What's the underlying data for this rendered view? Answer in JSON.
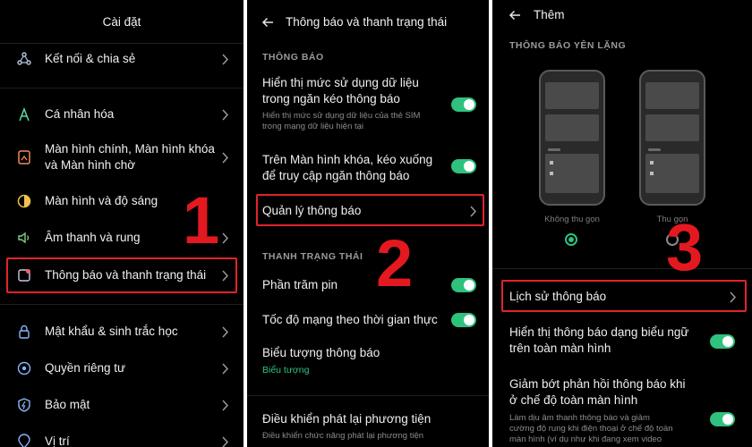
{
  "panel1": {
    "title": "Cài đặt",
    "items": [
      {
        "label": "Kết nối & chia sẻ",
        "icon": "share-icon"
      },
      {
        "label": "Cá nhân hóa",
        "icon": "brush-icon"
      },
      {
        "label": "Màn hình chính, Màn hình khóa\nvà Màn hình chờ",
        "icon": "home-screen-icon"
      },
      {
        "label": "Màn hình và độ sáng",
        "icon": "brightness-icon"
      },
      {
        "label": "Âm thanh và rung",
        "icon": "sound-icon"
      },
      {
        "label": "Thông báo và thanh trạng thái",
        "icon": "notification-icon"
      },
      {
        "label": "Mật khẩu & sinh trắc học",
        "icon": "lock-icon"
      },
      {
        "label": "Quyền riêng tư",
        "icon": "privacy-icon"
      },
      {
        "label": "Bảo mật",
        "icon": "shield-icon"
      },
      {
        "label": "Vị trí",
        "icon": "location-icon"
      }
    ],
    "step": "1"
  },
  "panel2": {
    "title": "Thông báo và thanh trạng thái",
    "section_notifications": "THÔNG BÁO",
    "item_data_usage": "Hiển thị mức sử dụng dữ liệu\ntrong ngăn kéo thông báo",
    "item_data_usage_sub": "Hiển thị mức sử dụng dữ liệu của thẻ SIM\ntrong mạng dữ liệu hiện tại",
    "item_lockscreen": "Trên Màn hình khóa, kéo xuống\nđể truy cập ngăn thông báo",
    "item_manage": "Quản lý thông báo",
    "section_statusbar": "THANH TRẠNG THÁI",
    "item_battery": "Phần trăm pin",
    "item_speed": "Tốc độ mạng theo thời gian thực",
    "item_icons": "Biểu tượng thông báo",
    "item_icons_value": "Biểu tượng",
    "item_media": "Điều khiển phát lại phương tiện",
    "item_media_sub": "Điều khiển chức năng phát lại phương tiện",
    "step": "2"
  },
  "panel3": {
    "title": "Thêm",
    "section_silent": "THÔNG BÁO YÊN LẶNG",
    "option_expanded": "Không thu gọn",
    "option_collapsed": "Thu gọn",
    "item_history": "Lịch sử thông báo",
    "item_banner": "Hiển thị thông báo dạng biểu ngữ\ntrên toàn màn hình",
    "item_reduce": "Giảm bớt phản hồi thông báo khi\nở chế độ toàn màn hình",
    "item_reduce_sub": "Làm dịu âm thanh thông báo và giảm\ncường độ rung khi điện thoại ở chế độ toàn\nmàn hình (ví dụ như khi đang xem video",
    "step": "3"
  },
  "colors": {
    "accent": "#2ec27e",
    "highlight": "#e0242b",
    "step_number": "#e3191f",
    "background": "#000000"
  }
}
